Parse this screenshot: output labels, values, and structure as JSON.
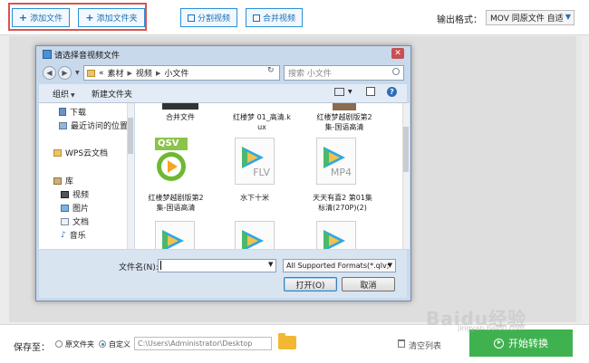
{
  "toolbar": {
    "add_file": "添加文件",
    "add_folder": "添加文件夹",
    "split_video": "分割视频",
    "merge_video": "合并视频",
    "output_format_label": "输出格式：",
    "output_format_value": "MOV  同原文件 自适"
  },
  "dialog": {
    "title": "请选择音视频文件",
    "close": "✕",
    "address": {
      "chevrons": "«",
      "parts": [
        "素材",
        "视频",
        "小文件"
      ]
    },
    "search_placeholder": "搜索 小文件",
    "commands": {
      "organize": "组织",
      "new_folder": "新建文件夹",
      "help": "?"
    },
    "nav": {
      "downloads": "下载",
      "recent": "最近访问的位置",
      "wps_cloud": "WPS云文档",
      "library": "库",
      "videos": "视频",
      "pictures": "图片",
      "documents": "文档",
      "music": "音乐"
    },
    "files": [
      {
        "name": "合并文件"
      },
      {
        "name": "红楼梦 01_高清.kux"
      },
      {
        "name": "红楼梦越剧版第2集-国语高清"
      },
      {
        "name": "红楼梦越剧版第2集-国语高清",
        "badge": "QSV"
      },
      {
        "name": "水下十米",
        "ext": "FLV"
      },
      {
        "name": "天天有喜2 第01集 标清(270P)(2)",
        "ext": "MP4"
      }
    ],
    "filename_label": "文件名(N):",
    "filename_value": "",
    "file_type": "All Supported Formats(*.qlv;",
    "open_button": "打开(O)",
    "cancel_button": "取消"
  },
  "bottom": {
    "save_to": "保存至：",
    "option_source": "原文件夹",
    "option_custom": "自定义",
    "path": "C:\\Users\\Administrator\\Desktop",
    "clear_list": "清空列表",
    "start": "开始转换"
  },
  "watermark": {
    "text": "Baidu经验",
    "sub": "jingyan.baidu.com"
  },
  "colors": {
    "accent": "#2a8fd6",
    "start_green": "#3fb24f",
    "highlight_red": "#d9534f"
  }
}
